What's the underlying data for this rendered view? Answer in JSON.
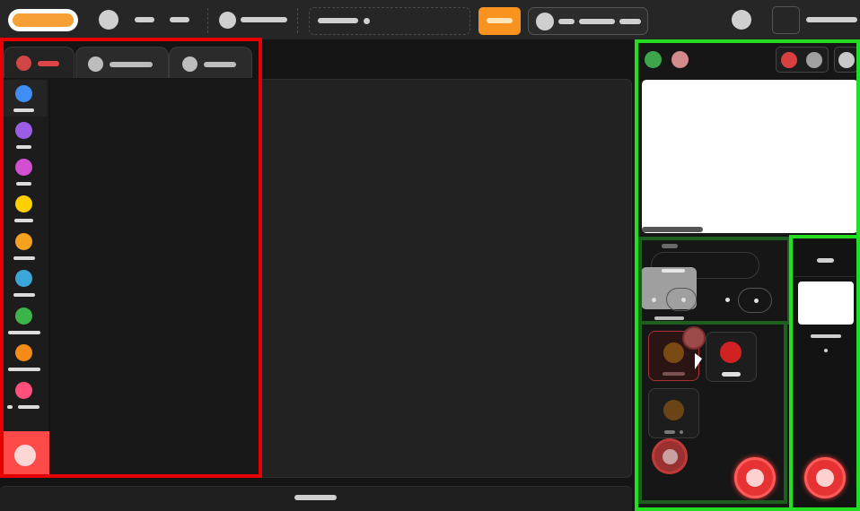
{
  "app": {
    "accent": "#f7a035",
    "danger": "#e64545"
  },
  "topbar": {
    "logo": "logo-icon",
    "controls": [
      "avatar-icon",
      "menu-item",
      "menu-item",
      "circle-icon",
      "dropdown",
      "search-input",
      "primary-button",
      "user-menu",
      "settings-icon",
      "window-toggle"
    ]
  },
  "left_panel": {
    "tabs": [
      {
        "icon": "tab-icon",
        "accent": "#e04545"
      },
      {
        "icon": "tab-icon",
        "accent": "#bdbdbd"
      },
      {
        "icon": "tab-icon",
        "accent": "#bdbdbd"
      }
    ],
    "rail_items": [
      {
        "icon": "blue-dot-icon",
        "color": "#3f8ef5"
      },
      {
        "icon": "purple-dot-icon",
        "color": "#9b5de5"
      },
      {
        "icon": "magenta-dot-icon",
        "color": "#d24fd1"
      },
      {
        "icon": "yellow-dot-icon",
        "color": "#ffd000"
      },
      {
        "icon": "orange-dot-icon",
        "color": "#f4a11f"
      },
      {
        "icon": "cyan-dot-icon",
        "color": "#3aa7d8"
      },
      {
        "icon": "green-dot-icon",
        "color": "#3bb54a"
      },
      {
        "icon": "orange-dot-icon",
        "color": "#f48b16"
      },
      {
        "icon": "pink-dot-icon",
        "color": "#ff4f7a"
      }
    ],
    "bottom_action": "add-icon"
  },
  "right_panel": {
    "preview_header": [
      "green-dot-icon",
      "pink-dot-icon",
      "red-dot-icon",
      "gray-dot-icon",
      "gray-dot-icon"
    ],
    "preview": "white-preview",
    "mini_controls": [
      "slider",
      "toggle",
      "toggle"
    ],
    "cards": [
      "card-dark-orange",
      "card-red",
      "card-dark-orange"
    ],
    "fab_labels": [
      "fab-add",
      "fab-add",
      "fab-add"
    ]
  }
}
